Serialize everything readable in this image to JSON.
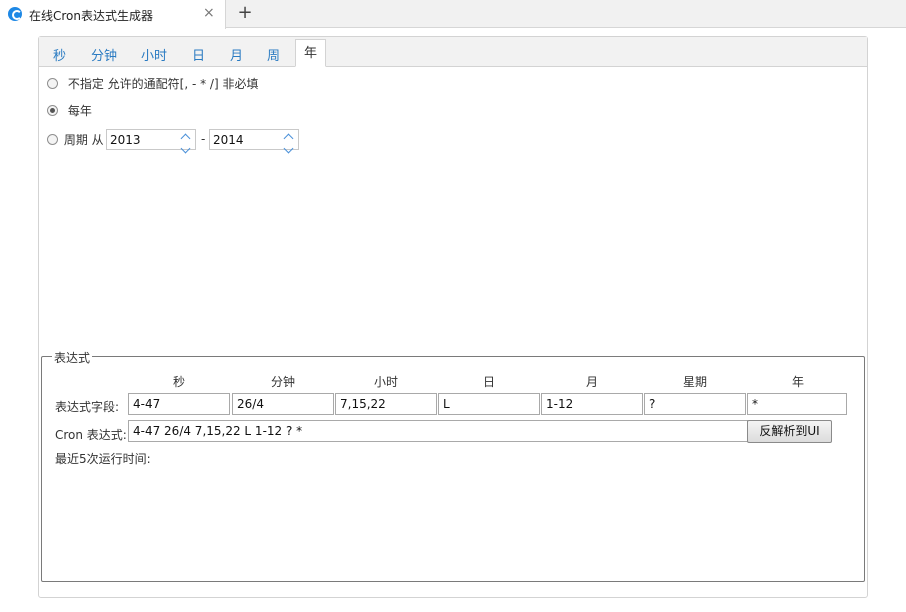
{
  "browser": {
    "tab_title": "在线Cron表达式生成器",
    "close_glyph": "×",
    "new_tab_glyph": "+"
  },
  "tabs": [
    "秒",
    "分钟",
    "小时",
    "日",
    "月",
    "周",
    "年"
  ],
  "active_tab": "年",
  "options": {
    "unspecified": "不指定 允许的通配符[, - * /] 非必填",
    "every_year": "每年",
    "period_label": "周期 从",
    "period_from": "2013",
    "period_sep": "-",
    "period_to": "2014",
    "selected": "every_year"
  },
  "expression": {
    "legend": "表达式",
    "columns": [
      "秒",
      "分钟",
      "小时",
      "日",
      "月",
      "星期",
      "年"
    ],
    "fields_label": "表达式字段:",
    "fields": [
      "4-47",
      "26/4",
      "7,15,22",
      "L",
      "1-12",
      "?",
      "*"
    ],
    "cron_label": "Cron 表达式:",
    "cron_value": "4-47 26/4 7,15,22 L 1-12 ? *",
    "parse_button": "反解析到UI",
    "recent_runs_label": "最近5次运行时间:"
  }
}
